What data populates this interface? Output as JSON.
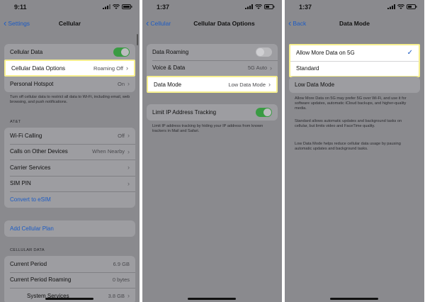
{
  "panel1": {
    "time": "9:11",
    "back": "Settings",
    "title": "Cellular",
    "group1": [
      {
        "label": "Cellular Data",
        "value": ""
      },
      {
        "label": "Cellular Data Options",
        "value": "Roaming Off"
      },
      {
        "label": "Personal Hotspot",
        "value": "On"
      }
    ],
    "footer1": "Turn off cellular data to restrict all data to Wi-Fi, including email, web browsing, and push notifications.",
    "section_carrier": "AT&T",
    "group2": [
      {
        "label": "Wi-Fi Calling",
        "value": "Off"
      },
      {
        "label": "Calls on Other Devices",
        "value": "When Nearby"
      },
      {
        "label": "Carrier Services",
        "value": ""
      },
      {
        "label": "SIM PIN",
        "value": ""
      },
      {
        "label": "Convert to eSIM",
        "value": ""
      }
    ],
    "add_plan": "Add Cellular Plan",
    "section_data": "CELLULAR DATA",
    "group3": [
      {
        "label": "Current Period",
        "value": "6.9 GB"
      },
      {
        "label": "Current Period Roaming",
        "value": "0 bytes"
      },
      {
        "label": "System Services",
        "value": "3.8 GB"
      }
    ],
    "cellular_data_on": true
  },
  "panel2": {
    "time": "1:37",
    "back": "Cellular",
    "title": "Cellular Data Options",
    "group1": [
      {
        "label": "Data Roaming",
        "value": ""
      },
      {
        "label": "Voice & Data",
        "value": "5G Auto"
      },
      {
        "label": "Data Mode",
        "value": "Low Data Mode"
      }
    ],
    "limit_ip_label": "Limit IP Address Tracking",
    "limit_ip_footer": "Limit IP address tracking by hiding your IP address from known trackers in Mail and Safari.",
    "data_roaming_on": false,
    "limit_ip_on": true
  },
  "panel3": {
    "time": "1:37",
    "back": "Back",
    "title": "Data Mode",
    "options": [
      {
        "label": "Allow More Data on 5G",
        "selected": true
      },
      {
        "label": "Standard",
        "selected": false
      },
      {
        "label": "Low Data Mode",
        "selected": false
      }
    ],
    "desc1": "Allow More Data on 5G may prefer 5G over Wi-Fi, and use it for software updates, automatic iCloud backups, and higher-quality media.",
    "desc2": "Standard allows automatic updates and background tasks on cellular, but limits video and FaceTime quality.",
    "desc3": "Low Data Mode helps reduce cellular data usage by pausing automatic updates and background tasks."
  },
  "colors": {
    "accent": "#1d5cc4",
    "toggle_on": "#3a9b43",
    "highlight_border": "#f6ef8f"
  },
  "icons": {
    "check": "✓",
    "chevron": "›",
    "back": "‹"
  }
}
